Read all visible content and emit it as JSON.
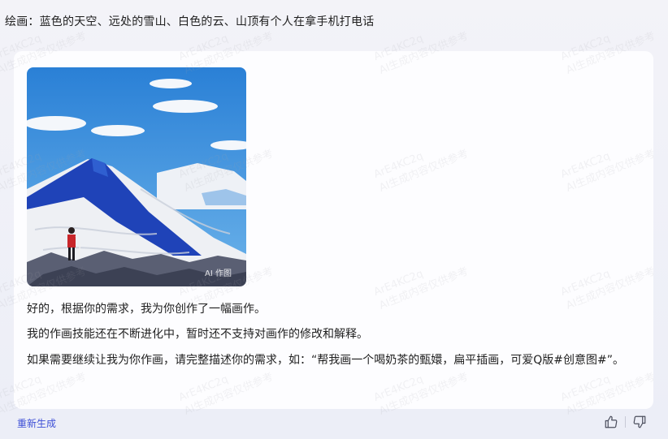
{
  "prompt_text": "绘画：蓝色的天空、远处的雪山、白色的云、山顶有个人在拿手机打电话",
  "image_tag": "AI 作图",
  "response": {
    "line1": "好的，根据你的需求，我为你创作了一幅画作。",
    "line2": "我的作画技能还在不断进化中，暂时还不支持对画作的修改和解释。",
    "line3": "如果需要继续让我为你作画，请完整描述你的需求，如：“帮我画一个喝奶茶的甄嬛，扁平插画，可爱Q版#创意图#”。"
  },
  "regenerate_label": "重新生成",
  "watermark": {
    "line1": "ArE4KC2q",
    "line2": "AI生成内容仅供参考"
  },
  "icons": [
    "thumbs-up-icon",
    "thumbs-down-icon"
  ],
  "colors": {
    "link": "#3d4fd6",
    "sky": "#2f86d8",
    "mountain_blue": "#1f43b8",
    "jacket": "#c8262a"
  }
}
